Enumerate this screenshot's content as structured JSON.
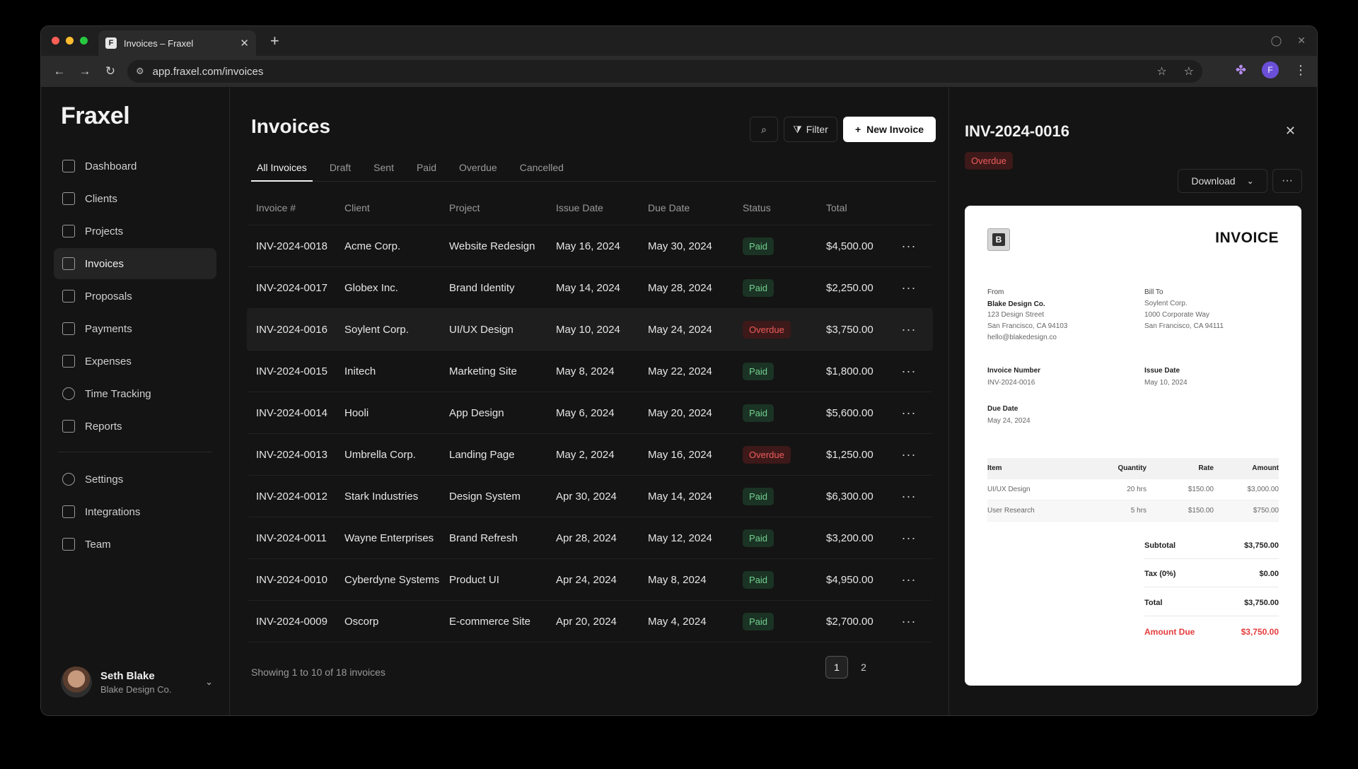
{
  "browser": {
    "tab_title": "Invoices – Fraxel",
    "favicon_letter": "F",
    "url": "app.fraxel.com/invoices",
    "profile_initial": "F"
  },
  "sidebar": {
    "brand": "Fraxel",
    "items": [
      {
        "label": "Dashboard",
        "icon": "dashboard-icon"
      },
      {
        "label": "Clients",
        "icon": "users-icon"
      },
      {
        "label": "Projects",
        "icon": "folder-icon"
      },
      {
        "label": "Invoices",
        "icon": "invoice-icon",
        "active": true
      },
      {
        "label": "Proposals",
        "icon": "document-icon"
      },
      {
        "label": "Payments",
        "icon": "wallet-icon"
      },
      {
        "label": "Expenses",
        "icon": "receipt-icon"
      },
      {
        "label": "Time Tracking",
        "icon": "clock-icon"
      },
      {
        "label": "Reports",
        "icon": "chart-icon"
      }
    ],
    "secondary_items": [
      {
        "label": "Settings",
        "icon": "gear-icon"
      },
      {
        "label": "Integrations",
        "icon": "puzzle-icon"
      },
      {
        "label": "Team",
        "icon": "team-icon"
      }
    ],
    "user": {
      "name": "Seth Blake",
      "org": "Blake Design Co."
    }
  },
  "main": {
    "title": "Invoices",
    "filter_label": "Filter",
    "new_label": "New Invoice",
    "tabs": [
      "All Invoices",
      "Draft",
      "Sent",
      "Paid",
      "Overdue",
      "Cancelled"
    ],
    "active_tab": "All Invoices",
    "columns": [
      "Invoice #",
      "Client",
      "Project",
      "Issue Date",
      "Due Date",
      "Status",
      "Total"
    ],
    "rows": [
      {
        "id": "INV-2024-0018",
        "client": "Acme Corp.",
        "project": "Website Redesign",
        "issue": "May 16, 2024",
        "due": "May 30, 2024",
        "status": "Paid",
        "total": "$4,500.00"
      },
      {
        "id": "INV-2024-0017",
        "client": "Globex Inc.",
        "project": "Brand Identity",
        "issue": "May 14, 2024",
        "due": "May 28, 2024",
        "status": "Paid",
        "total": "$2,250.00"
      },
      {
        "id": "INV-2024-0016",
        "client": "Soylent Corp.",
        "project": "UI/UX Design",
        "issue": "May 10, 2024",
        "due": "May 24, 2024",
        "status": "Overdue",
        "total": "$3,750.00",
        "selected": true
      },
      {
        "id": "INV-2024-0015",
        "client": "Initech",
        "project": "Marketing Site",
        "issue": "May 8, 2024",
        "due": "May 22, 2024",
        "status": "Paid",
        "total": "$1,800.00"
      },
      {
        "id": "INV-2024-0014",
        "client": "Hooli",
        "project": "App Design",
        "issue": "May 6, 2024",
        "due": "May 20, 2024",
        "status": "Paid",
        "total": "$5,600.00"
      },
      {
        "id": "INV-2024-0013",
        "client": "Umbrella Corp.",
        "project": "Landing Page",
        "issue": "May 2, 2024",
        "due": "May 16, 2024",
        "status": "Overdue",
        "total": "$1,250.00"
      },
      {
        "id": "INV-2024-0012",
        "client": "Stark Industries",
        "project": "Design System",
        "issue": "Apr 30, 2024",
        "due": "May 14, 2024",
        "status": "Paid",
        "total": "$6,300.00"
      },
      {
        "id": "INV-2024-0011",
        "client": "Wayne Enterprises",
        "project": "Brand Refresh",
        "issue": "Apr 28, 2024",
        "due": "May 12, 2024",
        "status": "Paid",
        "total": "$3,200.00"
      },
      {
        "id": "INV-2024-0010",
        "client": "Cyberdyne Systems",
        "project": "Product UI",
        "issue": "Apr 24, 2024",
        "due": "May 8, 2024",
        "status": "Paid",
        "total": "$4,950.00"
      },
      {
        "id": "INV-2024-0009",
        "client": "Oscorp",
        "project": "E-commerce Site",
        "issue": "Apr 20, 2024",
        "due": "May 4, 2024",
        "status": "Paid",
        "total": "$2,700.00"
      }
    ],
    "footer": "Showing 1 to 10 of 18 invoices",
    "pages": [
      "1",
      "2"
    ],
    "current_page": "1"
  },
  "panel": {
    "title": "INV-2024-0016",
    "status": "Overdue",
    "download_label": "Download",
    "invoice": {
      "heading": "INVOICE",
      "logo_letter": "B",
      "from_label": "From",
      "from_name": "Blake Design Co.",
      "from_lines": [
        "123 Design Street",
        "San Francisco, CA 94103",
        "hello@blakedesign.co"
      ],
      "bill_label": "Bill To",
      "bill_lines": [
        "Soylent Corp.",
        "1000 Corporate Way",
        "San Francisco, CA 94111"
      ],
      "number_label": "Invoice Number",
      "number": "INV-2024-0016",
      "issue_label": "Issue Date",
      "issue": "May 10, 2024",
      "due_label": "Due Date",
      "due": "May 24, 2024",
      "item_headers": [
        "Item",
        "Quantity",
        "Rate",
        "Amount"
      ],
      "items": [
        {
          "item": "UI/UX Design",
          "qty": "20 hrs",
          "rate": "$150.00",
          "amount": "$3,000.00"
        },
        {
          "item": "User Research",
          "qty": "5 hrs",
          "rate": "$150.00",
          "amount": "$750.00"
        }
      ],
      "subtotal_label": "Subtotal",
      "subtotal": "$3,750.00",
      "tax_label": "Tax (0%)",
      "tax": "$0.00",
      "total_label": "Total",
      "total": "$3,750.00",
      "due_amount_label": "Amount Due",
      "due_amount": "$3,750.00"
    }
  },
  "colors": {
    "paid": "#72d08f",
    "overdue": "#ef5c5c",
    "amount_due": "#e63b3b"
  }
}
